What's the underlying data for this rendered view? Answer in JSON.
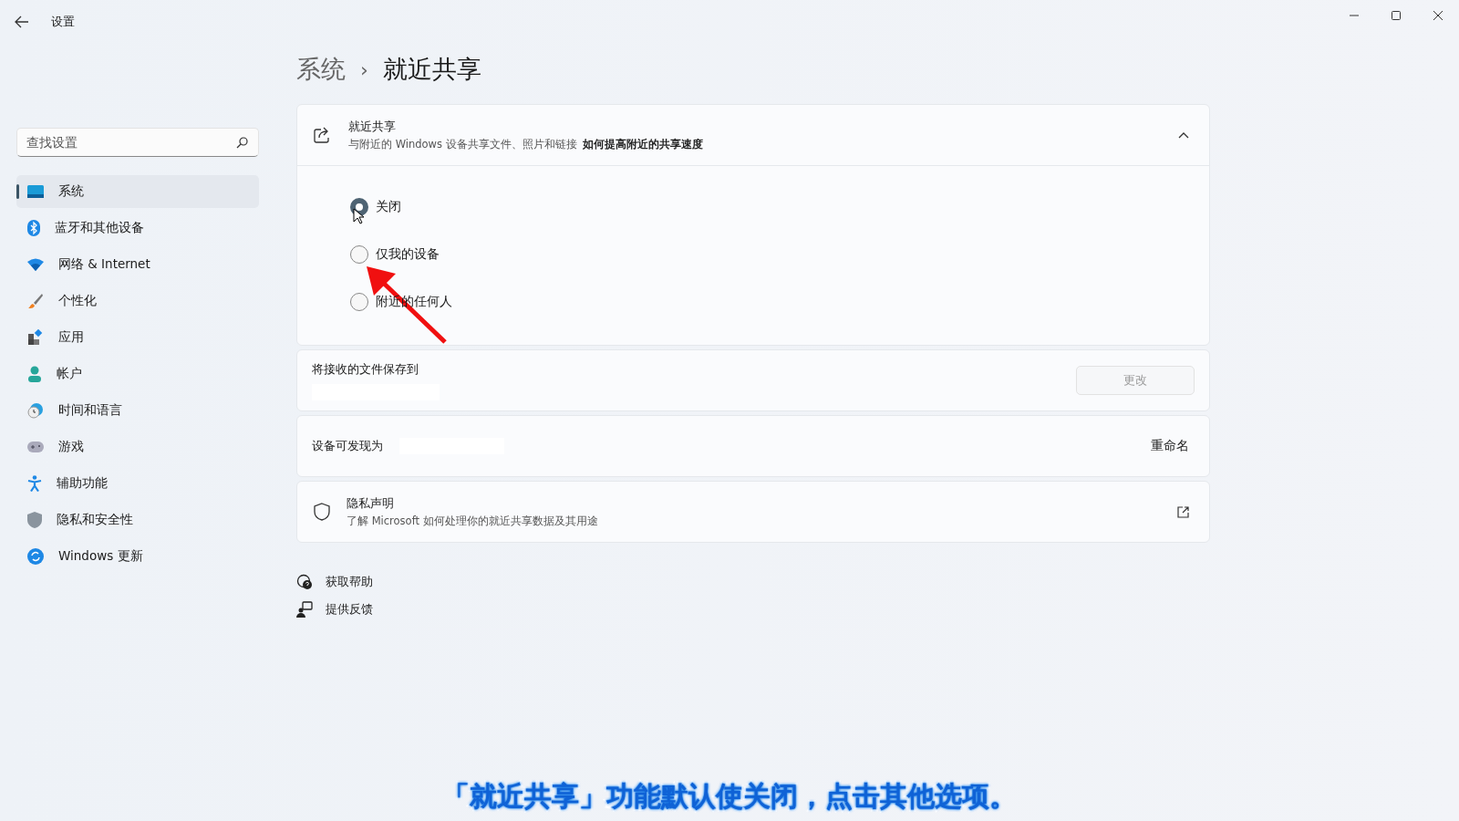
{
  "window": {
    "title": "设置"
  },
  "search": {
    "placeholder": "查找设置"
  },
  "sidebar": {
    "items": [
      {
        "label": "系统",
        "selected": true
      },
      {
        "label": "蓝牙和其他设备",
        "selected": false
      },
      {
        "label": "网络 & Internet",
        "selected": false
      },
      {
        "label": "个性化",
        "selected": false
      },
      {
        "label": "应用",
        "selected": false
      },
      {
        "label": "帐户",
        "selected": false
      },
      {
        "label": "时间和语言",
        "selected": false
      },
      {
        "label": "游戏",
        "selected": false
      },
      {
        "label": "辅助功能",
        "selected": false
      },
      {
        "label": "隐私和安全性",
        "selected": false
      },
      {
        "label": "Windows 更新",
        "selected": false
      }
    ]
  },
  "breadcrumb": {
    "parent": "系统",
    "separator": "›",
    "current": "就近共享"
  },
  "nearby_sharing": {
    "title": "就近共享",
    "description": "与附近的 Windows 设备共享文件、照片和链接",
    "link": "如何提高附近的共享速度",
    "expanded": true,
    "options": [
      {
        "label": "关闭",
        "selected": true
      },
      {
        "label": "仅我的设备",
        "selected": false
      },
      {
        "label": "附近的任何人",
        "selected": false
      }
    ]
  },
  "save_location": {
    "label": "将接收的文件保存到",
    "button": "更改",
    "button_disabled": true
  },
  "discoverable": {
    "label": "设备可发现为",
    "action": "重命名"
  },
  "privacy": {
    "title": "隐私声明",
    "description": "了解 Microsoft 如何处理你的就近共享数据及其用途"
  },
  "footer_links": [
    {
      "label": "获取帮助"
    },
    {
      "label": "提供反馈"
    }
  ],
  "caption": "「就近共享」功能默认使关闭，点击其他选项。"
}
